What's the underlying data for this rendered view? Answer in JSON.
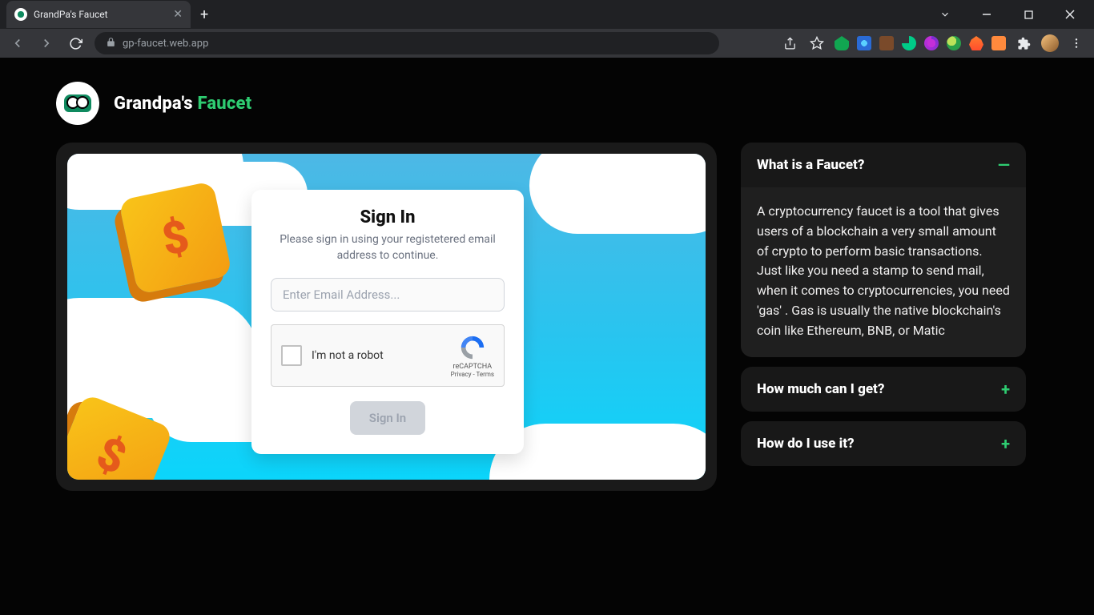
{
  "browser": {
    "tab_title": "GrandPa's Faucet",
    "url": "gp-faucet.web.app"
  },
  "brand": {
    "part1": "Grandpa's ",
    "part2": "Faucet"
  },
  "signin": {
    "title": "Sign In",
    "subtitle": "Please sign in using your registetered email address to continue.",
    "email_placeholder": "Enter Email Address...",
    "recaptcha_label": "I'm not a robot",
    "recaptcha_brand": "reCAPTCHA",
    "recaptcha_links": "Privacy - Terms",
    "button": "Sign In"
  },
  "faq": {
    "items": [
      {
        "question": "What is a Faucet?",
        "answer": "A cryptocurrency faucet is a tool that gives users of a blockchain a very small amount of crypto to perform basic transactions. Just like you need a stamp to send mail, when it comes to cryptocurrencies, you need 'gas' . Gas is usually the native blockchain's coin like Ethereum, BNB, or Matic",
        "expanded": true,
        "toggle": "—"
      },
      {
        "question": "How much can I get?",
        "expanded": false,
        "toggle": "+"
      },
      {
        "question": "How do I use it?",
        "expanded": false,
        "toggle": "+"
      }
    ]
  }
}
